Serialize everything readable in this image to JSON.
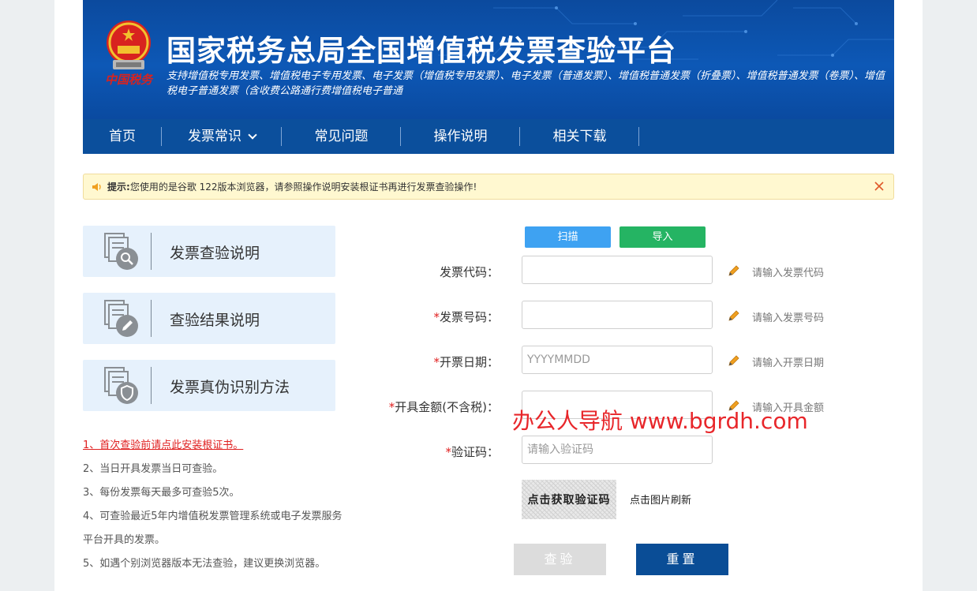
{
  "header": {
    "emblem_text": "中国税务",
    "title": "国家税务总局全国增值税发票查验平台",
    "subtitle": "支持增值税专用发票、增值税电子专用发票、电子发票（增值税专用发票）、电子发票（普通发票）、增值税普通发票（折叠票）、增值税普通发票（卷票）、增值税电子普通发票（含收费公路通行费增值税电子普通"
  },
  "nav": {
    "items": [
      {
        "label": "首页"
      },
      {
        "label": "发票常识",
        "has_dropdown": true
      },
      {
        "label": "常见问题"
      },
      {
        "label": "操作说明"
      },
      {
        "label": "相关下载"
      }
    ]
  },
  "notice": {
    "icon": "speaker-icon",
    "label": "提示:",
    "text": " 您使用的是谷歌 122版本浏览器，请参照操作说明安装根证书再进行发票查验操作!"
  },
  "sidebar": {
    "cards": [
      {
        "label": "发票查验说明",
        "icon": "document-search-icon"
      },
      {
        "label": "查验结果说明",
        "icon": "document-edit-icon"
      },
      {
        "label": "发票真伪识别方法",
        "icon": "document-shield-icon"
      }
    ],
    "rules": [
      "1、首次查验前请点此安装根证书。",
      "2、当日开具发票当日可查验。",
      "3、每份发票每天最多可查验5次。",
      "4、可查验最近5年内增值税发票管理系统或电子发票服务",
      "平台开具的发票。",
      "5、如遇个别浏览器版本无法查验，建议更换浏览器。"
    ]
  },
  "form": {
    "scan_label": "扫描",
    "import_label": "导入",
    "fields": [
      {
        "label": "发票代码：",
        "required": false,
        "value": "",
        "placeholder": "",
        "hint": "请输入发票代码"
      },
      {
        "label": "发票号码：",
        "required": true,
        "value": "",
        "placeholder": "",
        "hint": "请输入发票号码"
      },
      {
        "label": "开票日期：",
        "required": true,
        "value": "",
        "placeholder": "YYYYMMDD",
        "hint": "请输入开票日期"
      },
      {
        "label": "开具金额(不含税)：",
        "required": true,
        "value": "",
        "placeholder": "",
        "hint": "请输入开具金额"
      },
      {
        "label": "验证码：",
        "required": true,
        "value": "",
        "placeholder": "请输入验证码",
        "hint": ""
      }
    ],
    "required_mark": "*",
    "captcha_text": "点击获取验证码",
    "refresh_label": "点击图片刷新",
    "submit_label": "查验",
    "reset_label": "重置"
  },
  "watermark": "办公人导航  www.bgrdh.com",
  "colors": {
    "banner": "#0d58b6",
    "nav": "#0b4f9c",
    "scan": "#3ea2f2",
    "import": "#25b463",
    "submit_disabled": "#dcdcdc",
    "reset": "#0a4d96",
    "required": "#e02020"
  }
}
